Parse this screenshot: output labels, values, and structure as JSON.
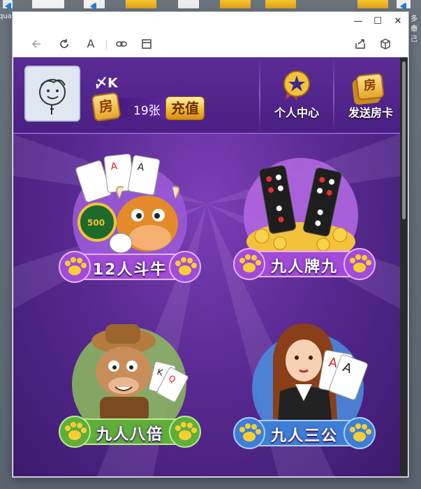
{
  "desktop": {
    "labels": [
      "qua",
      "多个",
      "自己"
    ]
  },
  "window": {
    "controls": {
      "minimize": "—",
      "maximize": "☐",
      "close": "✕"
    }
  },
  "toolbar": {
    "reader_label": "A"
  },
  "player": {
    "name": "〆K",
    "room_card_icon_text": "房",
    "card_count": "19张",
    "recharge_label": "充值"
  },
  "header_actions": [
    {
      "label": "个人中心",
      "icon_text": "★"
    },
    {
      "label": "发送房卡",
      "icon_text": "房"
    }
  ],
  "games": [
    {
      "label": "12人斗牛"
    },
    {
      "label": "九人牌九"
    },
    {
      "label": "九人八倍"
    },
    {
      "label": "九人三公"
    }
  ],
  "colors": {
    "game_bg": "#5a2a93",
    "banner_purple": "#a14bd8",
    "banner_green": "#5fae3a",
    "banner_blue": "#3d7fd8",
    "gold": "#f0b830"
  }
}
